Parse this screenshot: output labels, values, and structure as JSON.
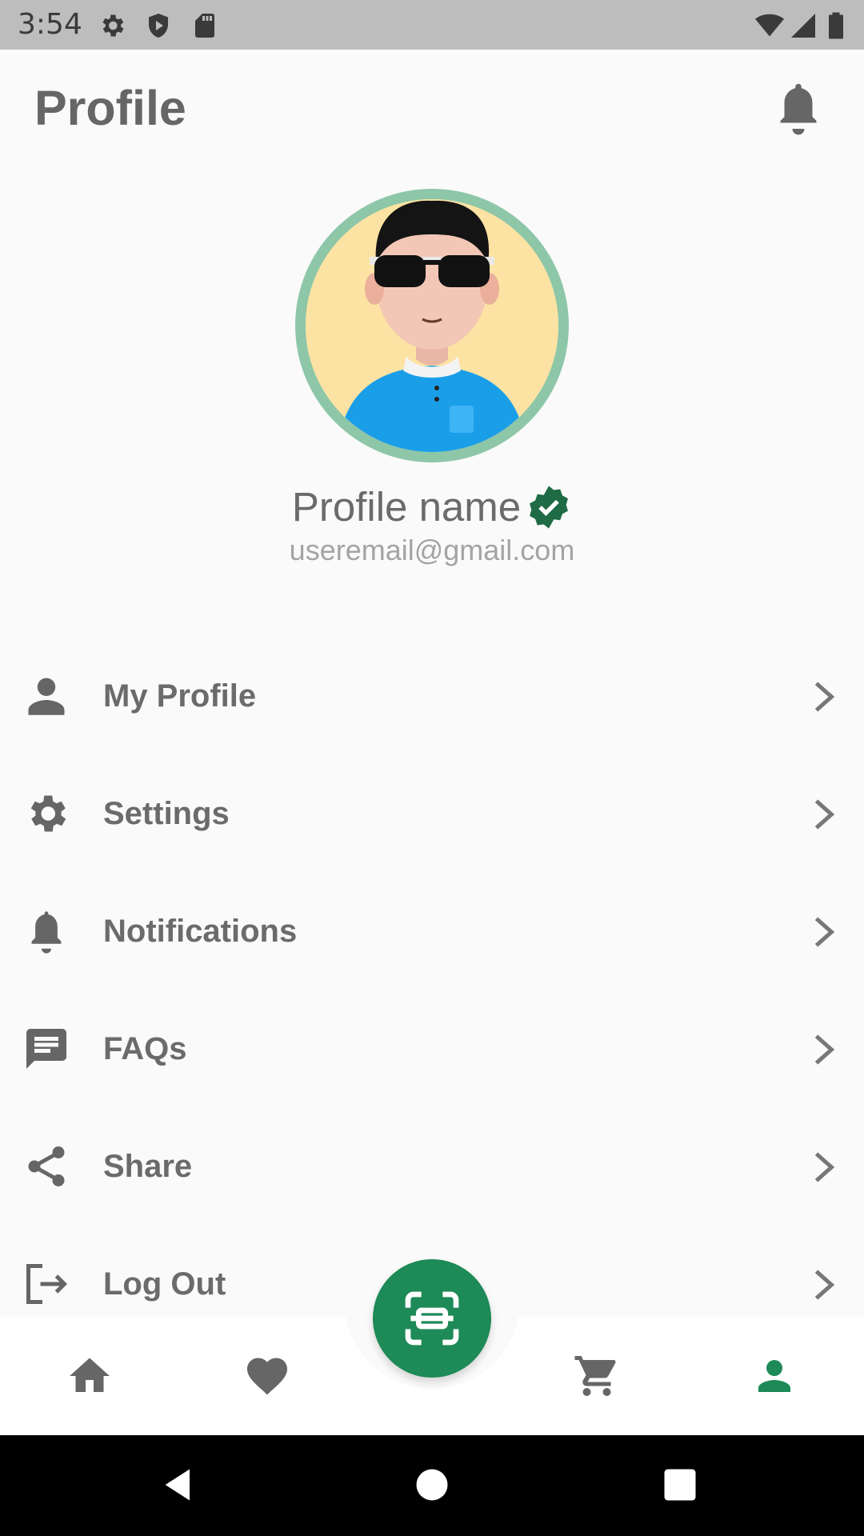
{
  "status_bar": {
    "time": "3:54",
    "left_icons": [
      "gear-icon",
      "shield-icon",
      "sd-card-icon"
    ],
    "right_icons": [
      "wifi-icon",
      "signal-icon",
      "battery-icon"
    ]
  },
  "header": {
    "title": "Profile",
    "bell_icon": "bell-icon"
  },
  "profile": {
    "name": "Profile name",
    "email": "useremail@gmail.com",
    "verified_icon": "verified-badge-icon",
    "ring_color": "#8ec6a8"
  },
  "menu": {
    "items": [
      {
        "label": "My Profile",
        "icon": "person-icon"
      },
      {
        "label": "Settings",
        "icon": "gear-icon"
      },
      {
        "label": "Notifications",
        "icon": "bell-icon"
      },
      {
        "label": "FAQs",
        "icon": "chat-icon"
      },
      {
        "label": "Share",
        "icon": "share-icon"
      },
      {
        "label": "Log Out",
        "icon": "logout-icon"
      }
    ]
  },
  "bottom_nav": {
    "items": [
      "home-icon",
      "heart-icon",
      "scan-icon",
      "cart-icon",
      "person-icon"
    ],
    "active": "person-icon",
    "accent_color": "#1e8a57"
  },
  "system_nav": {
    "buttons": [
      "back-icon",
      "home-circle-icon",
      "recents-icon"
    ]
  }
}
